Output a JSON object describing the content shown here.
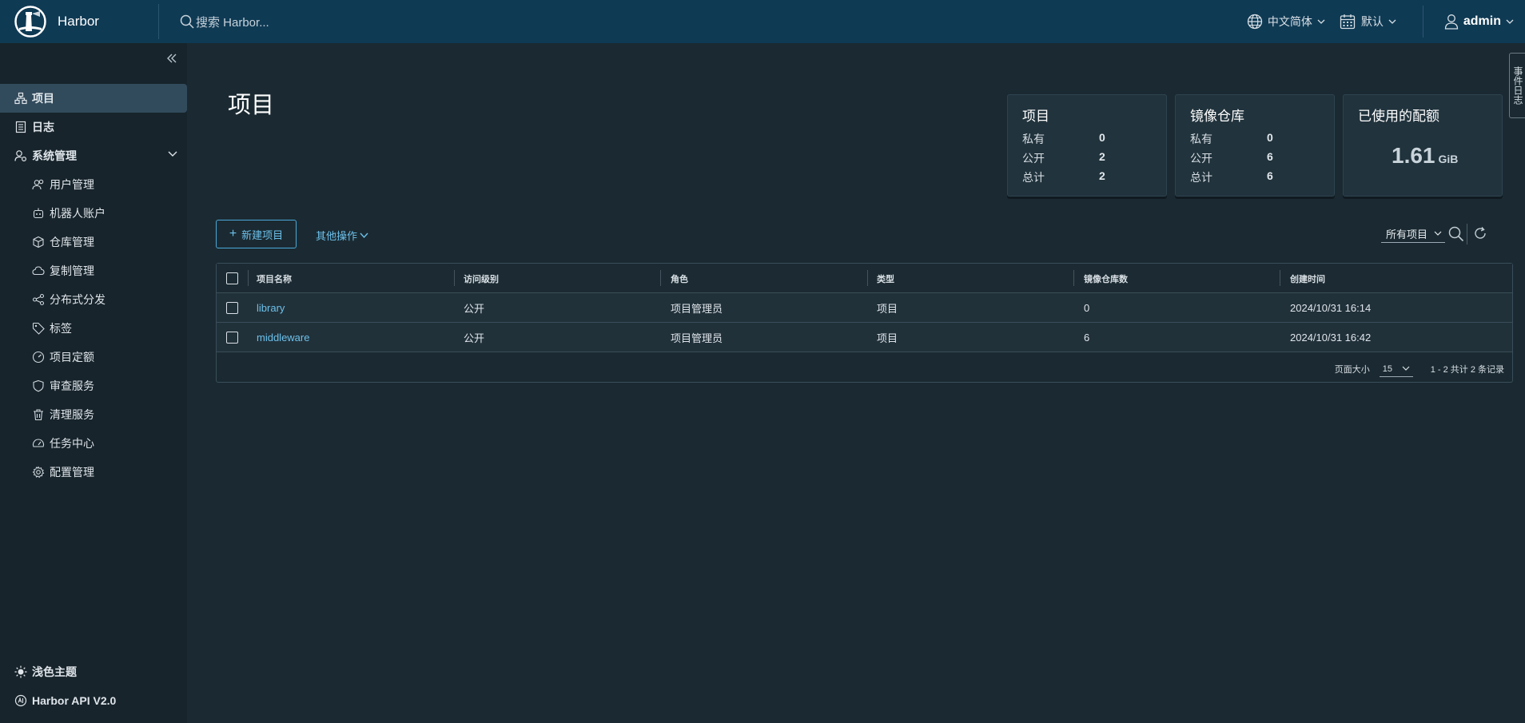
{
  "header": {
    "brand": "Harbor",
    "search_placeholder": "搜索 Harbor...",
    "language": "中文简体",
    "datetime_format": "默认",
    "user": "admin"
  },
  "sidebar": {
    "items": [
      {
        "label": "项目",
        "icon": "projects-icon",
        "active": true
      },
      {
        "label": "日志",
        "icon": "logs-icon"
      },
      {
        "label": "系统管理",
        "icon": "admin-icon"
      },
      {
        "label": "用户管理",
        "icon": "users-icon"
      },
      {
        "label": "机器人账户",
        "icon": "robot-icon"
      },
      {
        "label": "仓库管理",
        "icon": "registry-icon"
      },
      {
        "label": "复制管理",
        "icon": "replication-icon"
      },
      {
        "label": "分布式分发",
        "icon": "share-icon"
      },
      {
        "label": "标签",
        "icon": "tag-icon"
      },
      {
        "label": "项目定额",
        "icon": "quota-icon"
      },
      {
        "label": "审查服务",
        "icon": "shield-icon"
      },
      {
        "label": "清理服务",
        "icon": "trash-icon"
      },
      {
        "label": "任务中心",
        "icon": "dashboard-icon"
      },
      {
        "label": "配置管理",
        "icon": "gear-icon"
      }
    ],
    "theme_toggle": "浅色主题",
    "api_link": "Harbor API V2.0"
  },
  "page": {
    "title": "项目"
  },
  "cards": {
    "projects": {
      "title": "项目",
      "private_label": "私有",
      "private": "0",
      "public_label": "公开",
      "public": "2",
      "total_label": "总计",
      "total": "2"
    },
    "repositories": {
      "title": "镜像仓库",
      "private_label": "私有",
      "private": "0",
      "public_label": "公开",
      "public": "6",
      "total_label": "总计",
      "total": "6"
    },
    "quota": {
      "title": "已使用的配额",
      "value": "1.61",
      "unit": "GiB"
    }
  },
  "toolbar": {
    "new_project": "新建项目",
    "more_actions": "其他操作",
    "filter": "所有项目"
  },
  "table": {
    "columns": [
      "项目名称",
      "访问级别",
      "角色",
      "类型",
      "镜像仓库数",
      "创建时间"
    ],
    "rows": [
      [
        "library",
        "公开",
        "项目管理员",
        "项目",
        "0",
        "2024/10/31 16:14"
      ],
      [
        "middleware",
        "公开",
        "项目管理员",
        "项目",
        "6",
        "2024/10/31 16:42"
      ]
    ],
    "page_size_label": "页面大小",
    "page_size": "15",
    "count_text": "1 - 2 共计 2 条记录"
  },
  "side_tab": "事件日志",
  "colors": {
    "header_bg": "#0f3a54",
    "sidebar_bg": "#17242b",
    "main_bg": "#1b2a32",
    "accent": "#6cc0ea"
  }
}
